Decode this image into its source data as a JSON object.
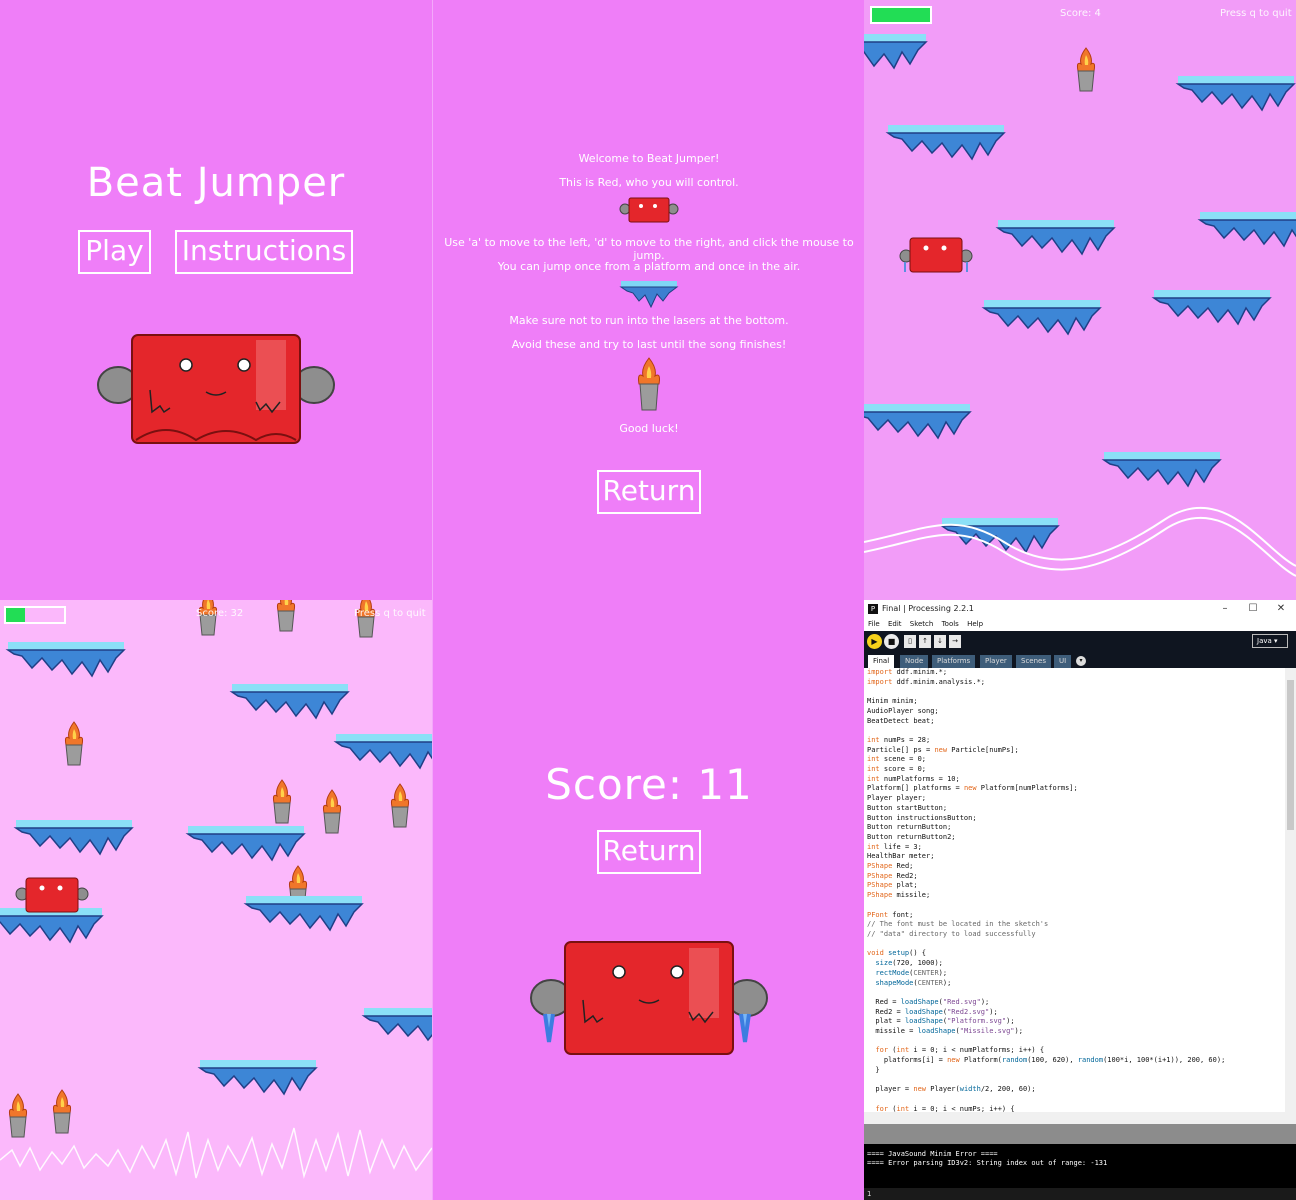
{
  "title_screen": {
    "title": "Beat Jumper",
    "play_label": "Play",
    "instructions_label": "Instructions"
  },
  "instructions_screen": {
    "lines": [
      "Welcome to Beat Jumper!",
      "This is Red, who you will control.",
      "Use 'a' to move to the left, 'd' to move to the right, and click the mouse to jump.",
      "You can jump once from a platform and once in the air.",
      "Make sure not to run into the lasers at the bottom.",
      "Avoid these and try to last until the song finishes!",
      "Good luck!"
    ],
    "return_label": "Return"
  },
  "game_screen_1": {
    "score_text": "Score: 4",
    "quit_hint": "Press q to quit",
    "health_fraction": 1.0
  },
  "game_screen_2": {
    "score_text": "Score: 32",
    "quit_hint": "Press q to quit",
    "health_fraction": 0.33
  },
  "score_screen": {
    "score_text": "Score: 11",
    "return_label": "Return"
  },
  "ide": {
    "window_title": "Final | Processing 2.2.1",
    "app_icon": "P",
    "menus": [
      "File",
      "Edit",
      "Sketch",
      "Tools",
      "Help"
    ],
    "tabs": [
      "Final",
      "Node",
      "Platforms",
      "Player",
      "Scenes",
      "UI"
    ],
    "mode": "Java",
    "console_lines": [
      "==== JavaSound Minim Error ====",
      "==== Error parsing ID3v2: String index out of range: -131"
    ],
    "line_number": "1"
  },
  "colors": {
    "bg_pink": "#ef7ef8",
    "red_body": "#e4262b",
    "platform_blue": "#4aa8e6",
    "health_green": "#22dd55"
  }
}
